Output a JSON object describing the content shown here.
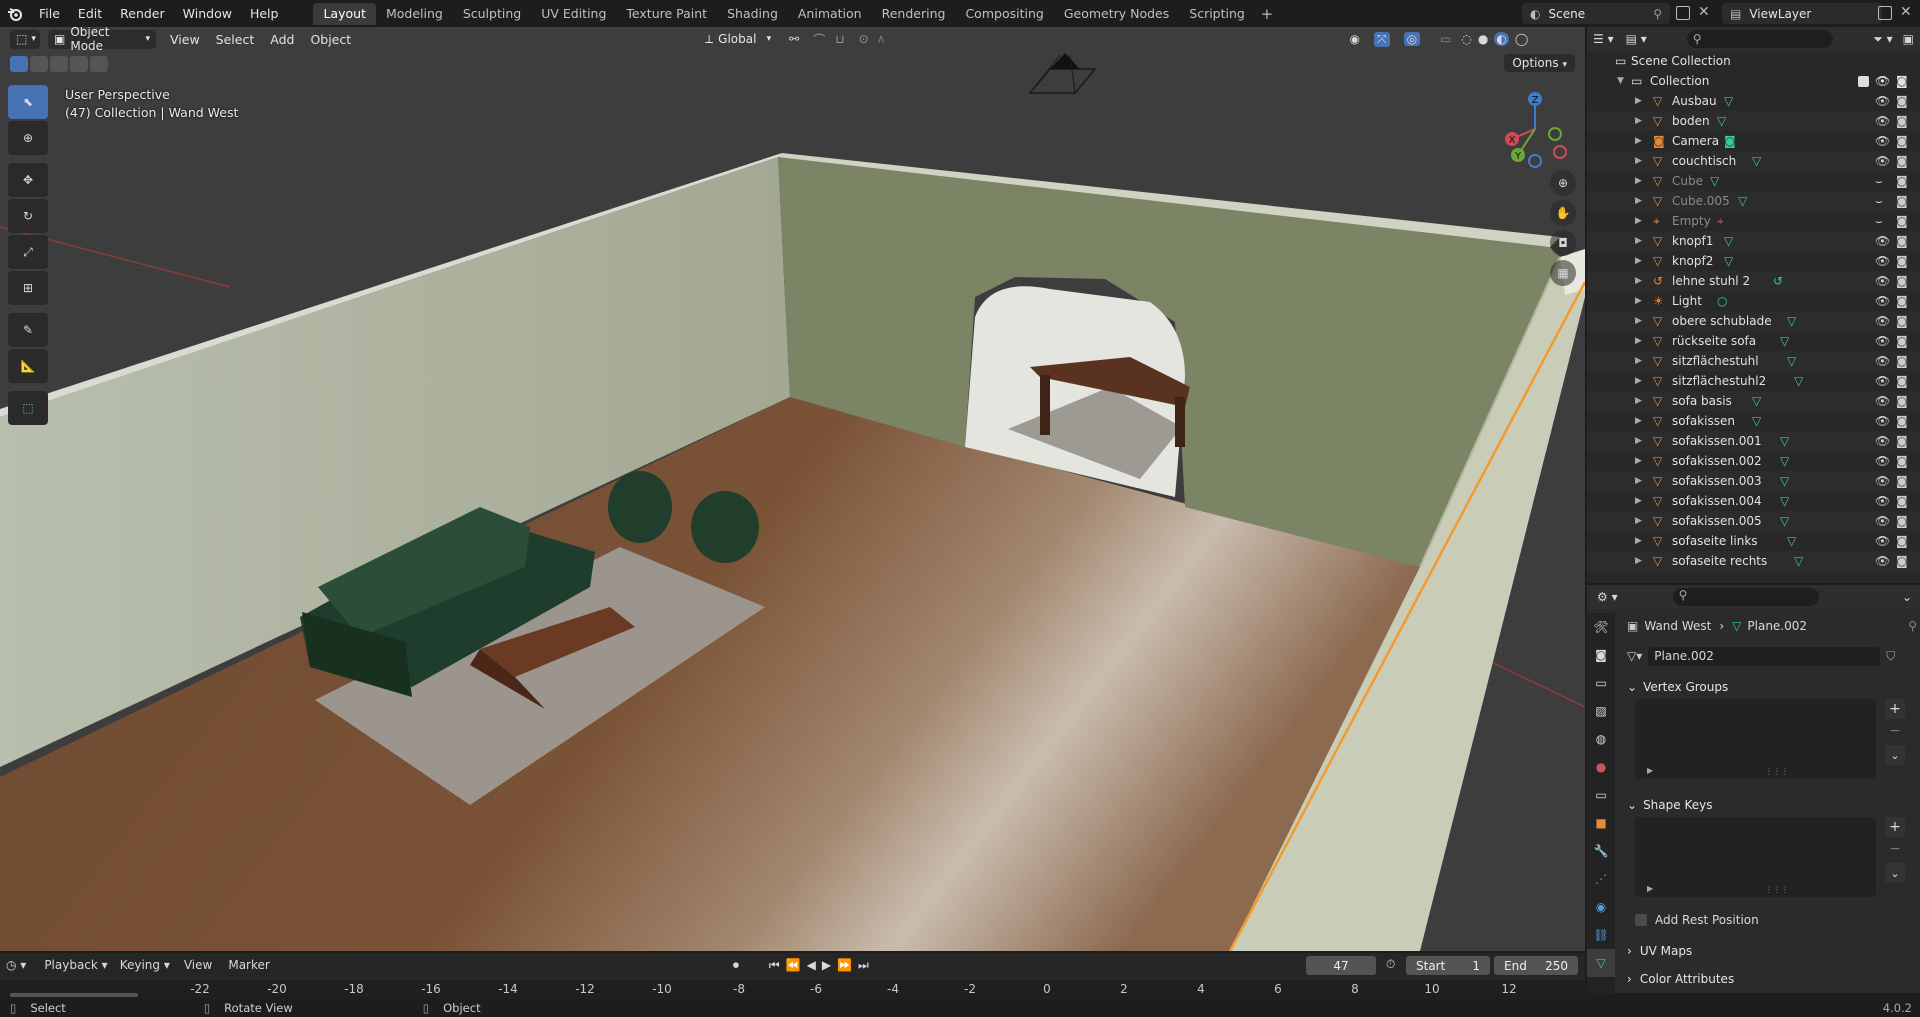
{
  "topbar": {
    "menus": [
      "File",
      "Edit",
      "Render",
      "Window",
      "Help"
    ],
    "workspaces": [
      "Layout",
      "Modeling",
      "Sculpting",
      "UV Editing",
      "Texture Paint",
      "Shading",
      "Animation",
      "Rendering",
      "Compositing",
      "Geometry Nodes",
      "Scripting"
    ],
    "active_workspace": "Layout",
    "add_tab": "+",
    "scene": "Scene",
    "view_layer": "ViewLayer"
  },
  "viewport": {
    "mode": "Object Mode",
    "menus": [
      "View",
      "Select",
      "Add",
      "Object"
    ],
    "orientation": "Global",
    "options": "Options",
    "info_line1": "User Perspective",
    "info_line2": "(47) Collection | Wand West",
    "gizmo_axes": {
      "x": "X",
      "y": "Y",
      "z": "Z"
    }
  },
  "outliner": {
    "scene_collection": "Scene Collection",
    "collection": "Collection",
    "items": [
      {
        "name": "Ausbau",
        "type": "mesh",
        "dim": false
      },
      {
        "name": "boden",
        "type": "mesh",
        "dim": false
      },
      {
        "name": "Camera",
        "type": "camera",
        "dim": false
      },
      {
        "name": "couchtisch",
        "type": "mesh",
        "dim": false
      },
      {
        "name": "Cube",
        "type": "mesh",
        "dim": true
      },
      {
        "name": "Cube.005",
        "type": "mesh",
        "dim": true
      },
      {
        "name": "Empty",
        "type": "empty",
        "dim": true
      },
      {
        "name": "knopf1",
        "type": "mesh",
        "dim": false
      },
      {
        "name": "knopf2",
        "type": "mesh",
        "dim": false
      },
      {
        "name": "lehne stuhl 2",
        "type": "curve",
        "dim": false
      },
      {
        "name": "Light",
        "type": "light",
        "dim": false
      },
      {
        "name": "obere schublade",
        "type": "mesh",
        "dim": false
      },
      {
        "name": "rückseite sofa",
        "type": "mesh",
        "dim": false
      },
      {
        "name": "sitzflächestuhl",
        "type": "mesh",
        "dim": false
      },
      {
        "name": "sitzflächestuhl2",
        "type": "mesh",
        "dim": false
      },
      {
        "name": "sofa basis",
        "type": "mesh",
        "dim": false
      },
      {
        "name": "sofakissen",
        "type": "mesh",
        "dim": false
      },
      {
        "name": "sofakissen.001",
        "type": "mesh",
        "dim": false
      },
      {
        "name": "sofakissen.002",
        "type": "mesh",
        "dim": false
      },
      {
        "name": "sofakissen.003",
        "type": "mesh",
        "dim": false
      },
      {
        "name": "sofakissen.004",
        "type": "mesh",
        "dim": false
      },
      {
        "name": "sofakissen.005",
        "type": "mesh",
        "dim": false
      },
      {
        "name": "sofaseite links",
        "type": "mesh",
        "dim": false
      },
      {
        "name": "sofaseite rechts",
        "type": "mesh",
        "dim": false
      }
    ]
  },
  "properties": {
    "breadcrumb_object": "Wand West",
    "breadcrumb_data": "Plane.002",
    "data_name": "Plane.002",
    "vertex_groups": "Vertex Groups",
    "shape_keys": "Shape Keys",
    "add_rest_position": "Add Rest Position",
    "uv_maps": "UV Maps",
    "color_attributes": "Color Attributes",
    "plus": "+",
    "minus": "−"
  },
  "timeline": {
    "menus": [
      "Playback",
      "Keying",
      "View",
      "Marker"
    ],
    "current_frame": "47",
    "start_label": "Start",
    "start": "1",
    "end_label": "End",
    "end": "250",
    "ruler": [
      "-22",
      "-20",
      "-18",
      "-16",
      "-14",
      "-12",
      "-10",
      "-8",
      "-6",
      "-4",
      "-2",
      "0",
      "2",
      "4",
      "6",
      "8",
      "10",
      "12"
    ]
  },
  "statusbar": {
    "select": "Select",
    "rotate": "Rotate View",
    "object": "Object",
    "version": "4.0.2"
  },
  "colors": {
    "accent": "#4772b3",
    "selection": "#f29a2e",
    "mesh_icon": "#e58a3a",
    "data_icon": "#38c9a0"
  }
}
